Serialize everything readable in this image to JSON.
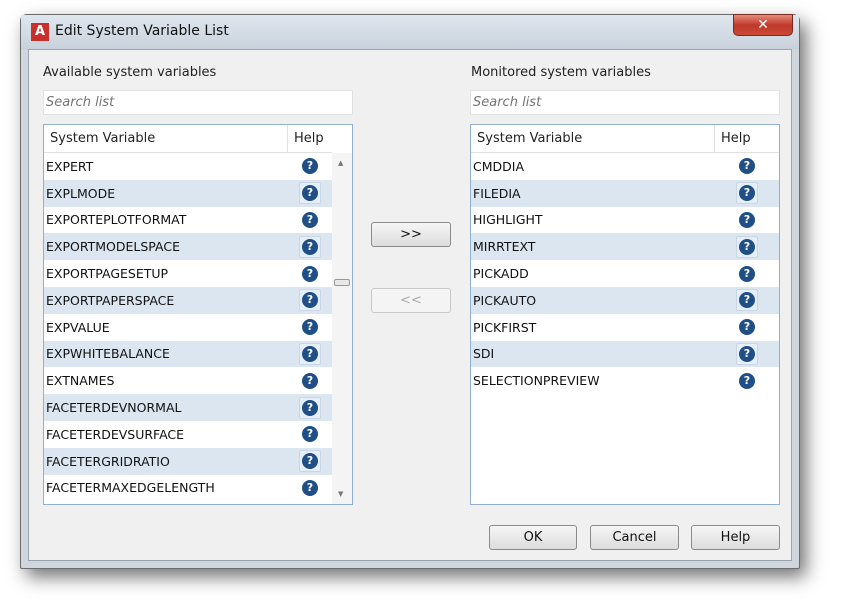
{
  "window": {
    "title": "Edit System Variable List",
    "close": "✕"
  },
  "available": {
    "label": "Available system variables",
    "search_placeholder": "Search list",
    "col_name": "System Variable",
    "col_help": "Help",
    "rows": [
      "EXPERT",
      "EXPLMODE",
      "EXPORTEPLOTFORMAT",
      "EXPORTMODELSPACE",
      "EXPORTPAGESETUP",
      "EXPORTPAPERSPACE",
      "EXPVALUE",
      "EXPWHITEBALANCE",
      "EXTNAMES",
      "FACETERDEVNORMAL",
      "FACETERDEVSURFACE",
      "FACETERGRIDRATIO",
      "FACETERMAXEDGELENGTH"
    ]
  },
  "monitored": {
    "label": "Monitored system variables",
    "search_placeholder": "Search list",
    "col_name": "System Variable",
    "col_help": "Help",
    "rows": [
      "CMDDIA",
      "FILEDIA",
      "HIGHLIGHT",
      "MIRRTEXT",
      "PICKADD",
      "PICKAUTO",
      "PICKFIRST",
      "SDI",
      "SELECTIONPREVIEW"
    ]
  },
  "buttons": {
    "add": ">>",
    "remove": "<<",
    "ok": "OK",
    "cancel": "Cancel",
    "help": "Help"
  },
  "help_glyph": "?"
}
